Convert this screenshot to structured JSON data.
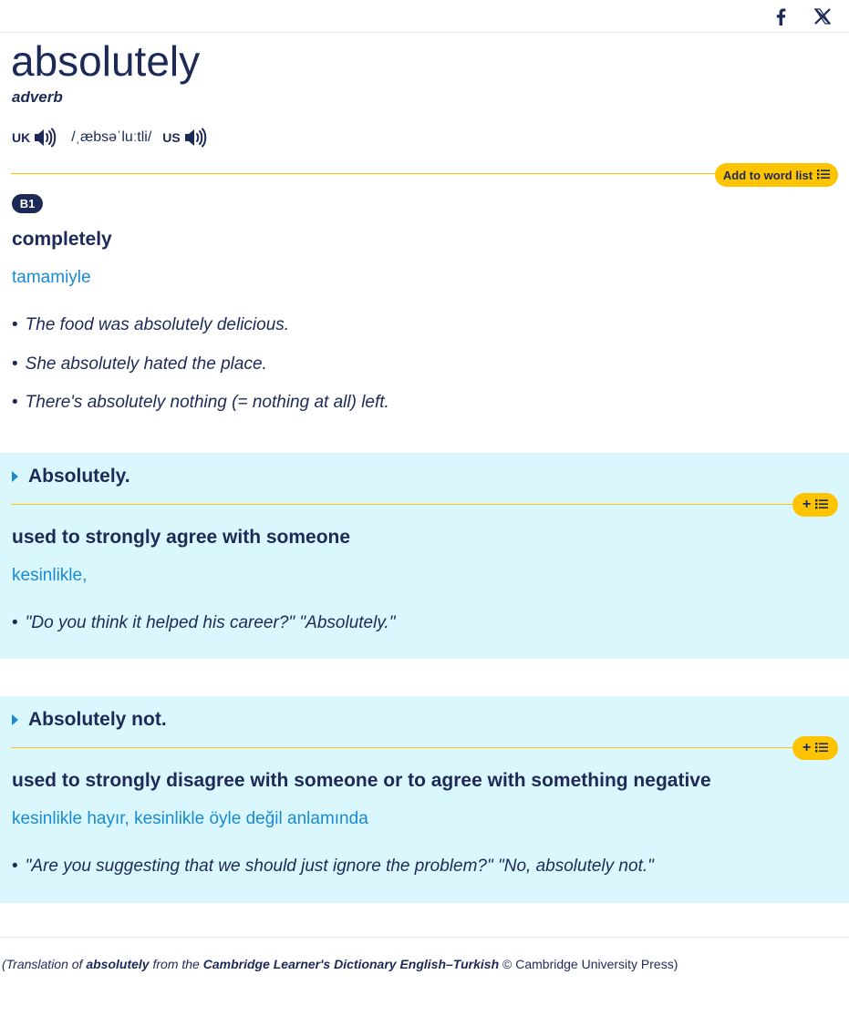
{
  "share": {
    "facebook_icon": "facebook-icon",
    "x_icon": "x-icon"
  },
  "entry": {
    "headword": "absolutely",
    "pos": "adverb",
    "pron": {
      "uk_label": "UK",
      "ipa": "/ˌæbsəˈluːtli/",
      "us_label": "US"
    },
    "wordlist_label": "Add to word list",
    "sense": {
      "level": "B1",
      "definition": "completely",
      "translation": "tamamiyle",
      "examples": [
        "The food was absolutely delicious.",
        "She absolutely hated the place.",
        "There's absolutely nothing (= nothing at all) left."
      ]
    }
  },
  "phrases": [
    {
      "title": "Absolutely.",
      "definition": "used to strongly agree with someone",
      "translation": "kesinlikle,",
      "examples": [
        "\"Do you think it helped his career?\" \"Absolutely.\""
      ]
    },
    {
      "title": "Absolutely not.",
      "definition": "used to strongly disagree with someone or to agree with something negative",
      "translation": "kesinlikle hayır, kesinlikle öyle değil anlamında",
      "examples": [
        "\"Are you suggesting that we should just ignore the problem?\" \"No, absolutely not.\""
      ]
    }
  ],
  "footer": {
    "prefix": "(Translation of ",
    "word": "absolutely",
    "middle": " from the ",
    "source": "Cambridge Learner's Dictionary English–Turkish",
    "suffix": " © Cambridge University Press)"
  },
  "colors": {
    "navy": "#1d2a57",
    "blue": "#1a8ad1",
    "yellow": "#fec400",
    "panel": "#d9f7fc"
  }
}
